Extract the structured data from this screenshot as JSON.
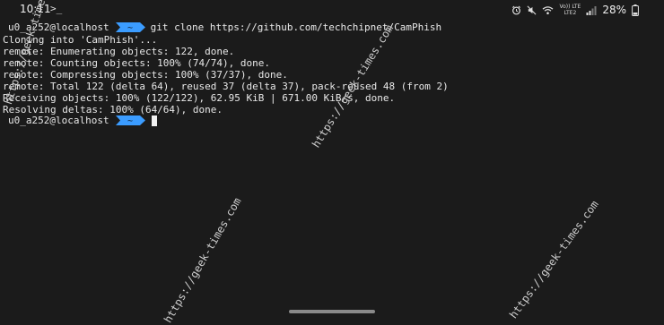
{
  "status_bar": {
    "time": "10:11",
    "app_indicator": ">_",
    "lte_top": "Vo)) LTE",
    "lte_bottom": "LTE2",
    "battery": "28%",
    "icons": [
      "alarm-icon",
      "mute-icon",
      "wifi-icon",
      "signal-icon",
      "battery-icon"
    ]
  },
  "terminal": {
    "prompt_user_host": "u0_a252@localhost",
    "prompt_dir": "~",
    "command": "git clone https://github.com/techchipnet/CamPhish",
    "output_lines": [
      "Cloning into 'CamPhish'...",
      "remote: Enumerating objects: 122, done.",
      "remote: Counting objects: 100% (74/74), done.",
      "remote: Compressing objects: 100% (37/37), done.",
      "remote: Total 122 (delta 64), reused 37 (delta 37), pack-reused 48 (from 2)",
      "Receiving objects: 100% (122/122), 62.95 KiB | 671.00 KiB/s, done.",
      "Resolving deltas: 100% (64/64), done."
    ],
    "prompt_badge_color": "#3b9cff"
  },
  "watermarks": [
    "https://geek-times.com",
    "https://geek-times.com",
    "https://geek-times.com",
    "https://geek-times.com"
  ]
}
